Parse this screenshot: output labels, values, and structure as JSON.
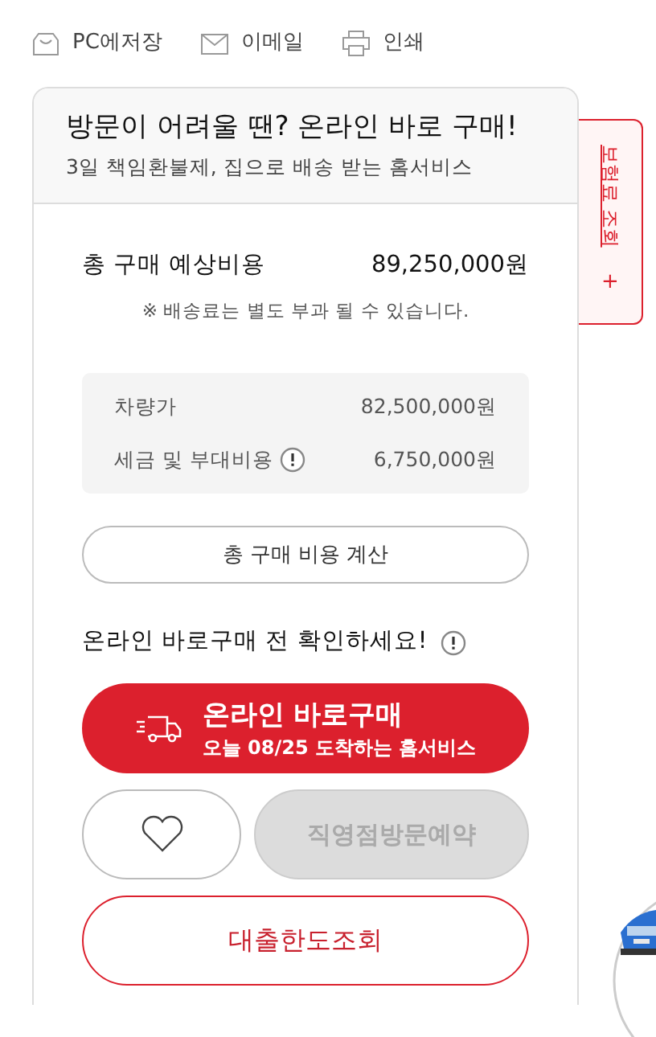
{
  "toolbar": [
    {
      "kind": "save",
      "label": "PC에저장"
    },
    {
      "kind": "email",
      "label": "이메일"
    },
    {
      "kind": "print",
      "label": "인쇄"
    }
  ],
  "side_tab": {
    "label": "보험료 조회",
    "plus": "+"
  },
  "card": {
    "title": "방문이 어려울 땐? 온라인 바로 구매!",
    "subtitle": "3일 책임환불제, 집으로 배송 받는 홈서비스",
    "total": {
      "label": "총 구매 예상비용",
      "value": "89,250,000원"
    },
    "note": "※ 배송료는 별도 부과 될 수 있습니다.",
    "breakdown": [
      {
        "label": "차량가",
        "value": "82,500,000원",
        "info": false
      },
      {
        "label": "세금 및 부대비용",
        "value": "6,750,000원",
        "info": true
      }
    ],
    "calc_button": "총 구매 비용 계산",
    "check_title": "온라인 바로구매 전 확인하세요!",
    "buy_button": {
      "label": "온라인 바로구매",
      "sub": "오늘 08/25 도착하는 홈서비스"
    },
    "visit_button": {
      "label": "직영점방문예약",
      "disabled": true
    },
    "loan_button": "대출한도조회"
  }
}
